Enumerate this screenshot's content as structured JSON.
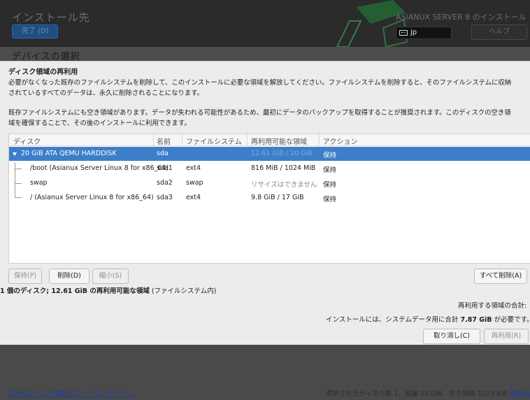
{
  "header": {
    "title": "インストール先",
    "done_label": "完了 (D)",
    "product_title": "ASIANUX SERVER 8 のインストール",
    "keyboard_layout": "jp",
    "help_label": "ヘルプ",
    "deco_color": "#1f8a3c"
  },
  "background": {
    "section_title": "デバイスの選択"
  },
  "dialog": {
    "title": "ディスク領域の再利用",
    "paragraph1_line1": "必要がなくなった既存のファイルシステムを削除して、このインストールに必要な領域を解放してください。ファイルシステムを削除すると、そのファイルシステムに収納",
    "paragraph1_line2": "されているすべてのデータは、永久に削除されることになります。",
    "paragraph2_line1": "既存ファイルシステムにも空き領域があります。データが失われる可能性があるため、最初にデータのバックアップを取得することが推奨されます。このディスクの空き領",
    "paragraph2_line2": "域を確保することで、その後のインストールに利用できます。",
    "columns": {
      "disk": "ディスク",
      "name": "名前",
      "filesystem": "ファイルシステム",
      "reclaimable": "再利用可能な領域",
      "action": "アクション"
    },
    "rows": [
      {
        "disk": "20 GiB ATA QEMU HARDDISK",
        "name": "sda",
        "filesystem": "",
        "reclaimable": "12.61 GiB / 20 GiB",
        "action": "保持"
      },
      {
        "disk": "/boot (Asianux Server Linux 8 for x86_64)",
        "name": "sda1",
        "filesystem": "ext4",
        "reclaimable": "816 MiB / 1024 MiB",
        "action": "保持"
      },
      {
        "disk": "swap",
        "name": "sda2",
        "filesystem": "swap",
        "reclaimable": "リサイズはできません",
        "action": "保持"
      },
      {
        "disk": "/ (Asianux Server Linux 8 for x86_64)",
        "name": "sda3",
        "filesystem": "ext4",
        "reclaimable": "9.8 GiB / 17 GiB",
        "action": "保持"
      }
    ],
    "buttons": {
      "preserve": "保持(P)",
      "delete": "削除(D)",
      "shrink": "縮小(S)",
      "delete_all": "すべて削除(A)",
      "cancel": "取り消し(C)",
      "reclaim": "再利用(R)"
    },
    "summary_bold": "1 個のディスク; 12.61 GiB の再利用可能な領域",
    "summary_rest": " (ファイルシステム内)",
    "reclaim_total_label": "再利用する領域の合計: ",
    "need_prefix": "インストールには、システムデータ用に合計 ",
    "need_value": "7.87 GiB",
    "need_suffix": " が必要です。",
    "selected_color": "#3d7ec9"
  },
  "footer": {
    "summary_link": "完全なディスク要約とブートローダー(F)...",
    "status": "選択されたディスク数 1、容量 20 GiB、空き領域 1023 KiB",
    "refresh_link": "更新(R)"
  }
}
